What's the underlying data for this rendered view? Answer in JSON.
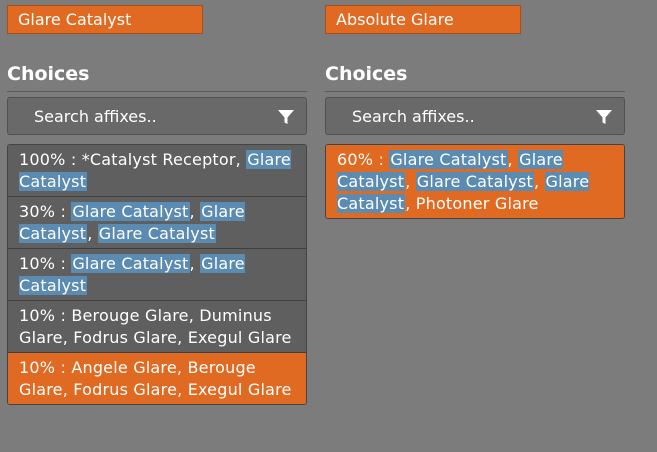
{
  "left_panel": {
    "header": "Glare Catalyst",
    "choices_title": "Choices",
    "search_placeholder": "Search affixes..",
    "items": [
      {
        "pct": "100% : ",
        "selected": false,
        "parts": [
          {
            "t": "*Catalyst Receptor",
            "h": false
          },
          {
            "t": ", ",
            "h": false
          },
          {
            "t": "Glare Catalyst",
            "h": true
          }
        ]
      },
      {
        "pct": "30% : ",
        "selected": false,
        "parts": [
          {
            "t": "Glare Catalyst",
            "h": true
          },
          {
            "t": ", ",
            "h": false
          },
          {
            "t": "Glare Catalyst",
            "h": true
          },
          {
            "t": ", ",
            "h": false
          },
          {
            "t": "Glare Catalyst",
            "h": true
          }
        ]
      },
      {
        "pct": "10% : ",
        "selected": false,
        "parts": [
          {
            "t": "Glare Catalyst",
            "h": true
          },
          {
            "t": ", ",
            "h": false
          },
          {
            "t": "Glare Catalyst",
            "h": true
          }
        ]
      },
      {
        "pct": "10% : ",
        "selected": false,
        "parts": [
          {
            "t": "Berouge Glare, Duminus Glare, Fodrus Glare, Exegul Glare",
            "h": false
          }
        ]
      },
      {
        "pct": "10% : ",
        "selected": true,
        "parts": [
          {
            "t": "Angele Glare, Berouge Glare, Fodrus Glare, Exegul Glare",
            "h": false
          }
        ]
      }
    ]
  },
  "right_panel": {
    "header": "Absolute Glare",
    "choices_title": "Choices",
    "search_placeholder": "Search affixes..",
    "items": [
      {
        "pct": "60% : ",
        "selected": true,
        "parts": [
          {
            "t": "Glare Catalyst",
            "h": true
          },
          {
            "t": ", ",
            "h": false
          },
          {
            "t": "Glare Catalyst",
            "h": true
          },
          {
            "t": ", ",
            "h": false
          },
          {
            "t": "Glare Catalyst",
            "h": true
          },
          {
            "t": ", ",
            "h": false
          },
          {
            "t": "Glare Catalyst",
            "h": true
          },
          {
            "t": ", Photoner Glare",
            "h": false
          }
        ]
      }
    ]
  },
  "icons": {
    "filter": "filter-icon"
  },
  "colors": {
    "background": "#7c7c7c",
    "accent": "#e06a22",
    "highlight": "#5b8bb1",
    "item_bg": "#5f5f5f"
  }
}
